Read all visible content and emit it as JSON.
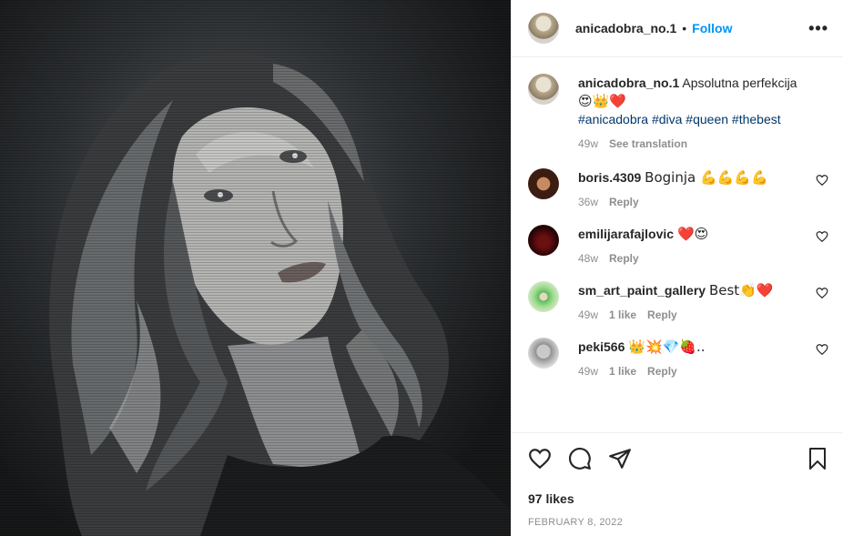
{
  "post": {
    "username": "anicadobra_no.1",
    "separator": "•",
    "follow_label": "Follow",
    "more_label": "•••"
  },
  "caption": {
    "username": "anicadobra_no.1",
    "text": "Apsolutna perfekcija",
    "emojis": "😍👑❤️",
    "hashtags": "#anicadobra #diva #queen #thebest",
    "time": "49w",
    "see_translation": "See translation"
  },
  "comments": [
    {
      "username": "boris.4309",
      "text": "Boginja 💪💪💪💪",
      "time": "36w",
      "likes": "",
      "reply": "Reply"
    },
    {
      "username": "emilijarafajlovic",
      "text": "❤️😍",
      "time": "48w",
      "likes": "",
      "reply": "Reply"
    },
    {
      "username": "sm_art_paint_gallery",
      "text": "Best👏❤️",
      "time": "49w",
      "likes": "1 like",
      "reply": "Reply"
    },
    {
      "username": "peki566",
      "text": "👑💥💎🍓..",
      "time": "49w",
      "likes": "1 like",
      "reply": "Reply"
    }
  ],
  "footer": {
    "likes": "97 likes",
    "date": "FEBRUARY 8, 2022"
  },
  "icons": {
    "like": "heart-icon",
    "comment": "comment-icon",
    "share": "share-icon",
    "save": "bookmark-icon",
    "more": "more-icon"
  },
  "colors": {
    "follow": "#0095f6",
    "hashtag": "#00376b",
    "meta": "#8e8e8e",
    "text": "#262626"
  }
}
